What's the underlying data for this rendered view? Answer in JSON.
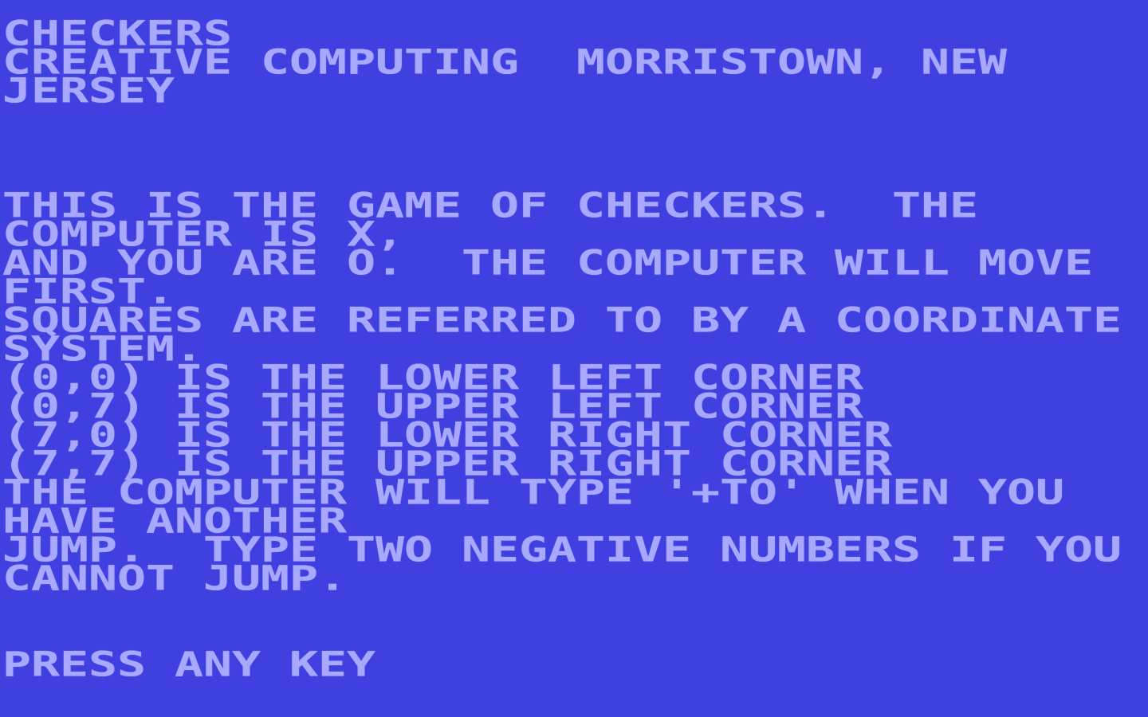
{
  "screen": {
    "background_color": "#4040E0",
    "text_color": "#A8A8FF",
    "columns": 40,
    "lines": [
      "CHECKERS",
      "CREATIVE COMPUTING  MORRISTOWN, NEW",
      "JERSEY",
      "",
      "",
      "",
      "THIS IS THE GAME OF CHECKERS.  THE",
      "COMPUTER IS X,",
      "AND YOU ARE O.  THE COMPUTER WILL MOVE",
      "FIRST.",
      "SQUARES ARE REFERRED TO BY A COORDINATE",
      "SYSTEM.",
      "(0,0) IS THE LOWER LEFT CORNER",
      "(0,7) IS THE UPPER LEFT CORNER",
      "(7,0) IS THE LOWER RIGHT CORNER",
      "(7,7) IS THE UPPER RIGHT CORNER",
      "THE COMPUTER WILL TYPE '+TO' WHEN YOU",
      "HAVE ANOTHER",
      "JUMP.  TYPE TWO NEGATIVE NUMBERS IF YOU",
      "CANNOT JUMP.",
      "",
      "",
      "PRESS ANY KEY"
    ]
  },
  "game": {
    "title": "CHECKERS",
    "publisher_line": "CREATIVE COMPUTING  MORRISTOWN, NEW JERSEY",
    "prompt": "PRESS ANY KEY"
  }
}
